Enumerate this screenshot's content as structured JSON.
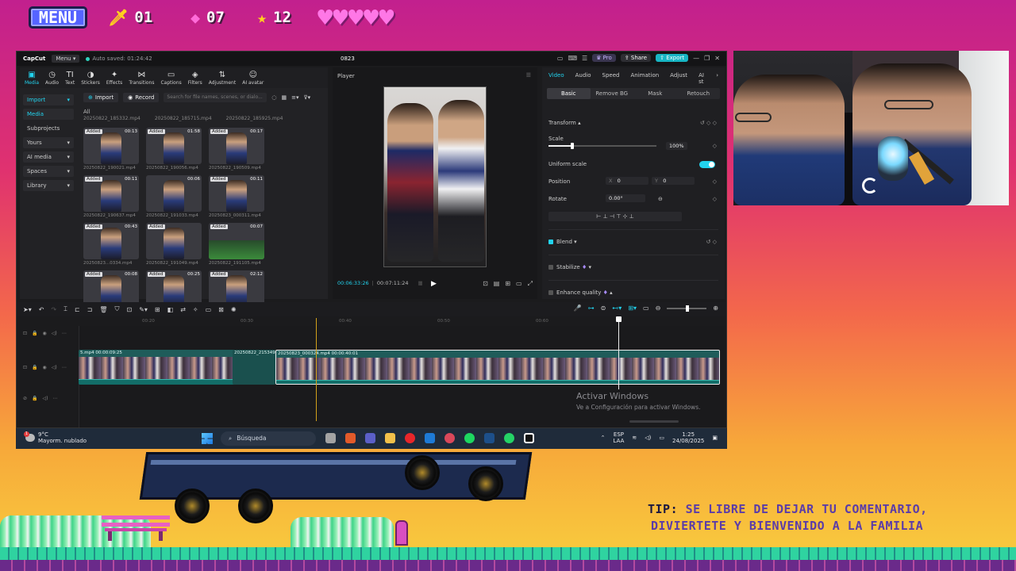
{
  "hud": {
    "menu_label": "MENU",
    "swords": "01",
    "gems": "07",
    "stars": "12",
    "hearts": "♥♥♥♥♥",
    "sword_icon": "sword-icon",
    "gem_icon": "gem-icon",
    "star_icon": "star-icon",
    "colors": {
      "menu_bg": "#5563ff",
      "hearts": "#ff77e6",
      "star": "#ffd21e"
    }
  },
  "capcut": {
    "app_name": "CapCut",
    "menu_label": "Menu",
    "auto_saved": "Auto saved: 01:24:42",
    "project_title": "0823",
    "pro_label": "Pro",
    "share_label": "Share",
    "export_label": "Export",
    "accent": "#22d3ee",
    "tools": [
      {
        "icon": "▣",
        "label": "Media"
      },
      {
        "icon": "◷",
        "label": "Audio"
      },
      {
        "icon": "TI",
        "label": "Text"
      },
      {
        "icon": "◑",
        "label": "Stickers"
      },
      {
        "icon": "✦",
        "label": "Effects"
      },
      {
        "icon": "⋈",
        "label": "Transitions"
      },
      {
        "icon": "▭",
        "label": "Captions"
      },
      {
        "icon": "◈",
        "label": "Filters"
      },
      {
        "icon": "⇅",
        "label": "Adjustment"
      },
      {
        "icon": "☺",
        "label": "AI avatar"
      }
    ],
    "side_nav": {
      "import": "Import",
      "media": "Media",
      "subprojects": "Subprojects",
      "yours": "Yours",
      "ai_media": "AI media",
      "spaces": "Spaces",
      "library": "Library"
    },
    "import_btn": "Import",
    "record_btn": "Record",
    "search_placeholder": "Search for file names, scenes, or dialo...",
    "all_label": "All",
    "top_files": [
      "20250822_185332.mp4",
      "20250822_185715.mp4",
      "20250822_185925.mp4"
    ],
    "clips": [
      {
        "badge": "Added",
        "duration": "00:13",
        "name": "20250822_190021.mp4"
      },
      {
        "badge": "Added",
        "duration": "01:58",
        "name": "20250822_190056.mp4"
      },
      {
        "badge": "Added",
        "duration": "00:17",
        "name": "20250822_190509.mp4"
      },
      {
        "badge": "Added",
        "duration": "00:11",
        "name": "20250822_190637.mp4"
      },
      {
        "badge": "",
        "duration": "00:06",
        "name": "20250822_191033.mp4"
      },
      {
        "badge": "Added",
        "duration": "00:11",
        "name": "20250823_000311.mp4"
      },
      {
        "badge": "Added",
        "duration": "00:43",
        "name": "20250823...0334.mp4"
      },
      {
        "badge": "Added",
        "duration": "",
        "name": "20250822_191049.mp4"
      },
      {
        "badge": "Added",
        "duration": "00:07",
        "name": "20250822_191105.mp4"
      },
      {
        "badge": "Added",
        "duration": "00:08",
        "name": ""
      },
      {
        "badge": "Added",
        "duration": "00:25",
        "name": ""
      },
      {
        "badge": "Added",
        "duration": "02:12",
        "name": ""
      }
    ],
    "player": {
      "title": "Player",
      "current": "00:06:33:26",
      "total": "00:07:11:24"
    },
    "inspector": {
      "tabs": [
        "Video",
        "Audio",
        "Speed",
        "Animation",
        "Adjust",
        "AI st"
      ],
      "sub_tabs": [
        "Basic",
        "Remove BG",
        "Mask",
        "Retouch"
      ],
      "transform": "Transform",
      "scale_label": "Scale",
      "scale_value": "100%",
      "scale_fraction": 0.22,
      "uniform_scale": "Uniform scale",
      "position_label": "Position",
      "pos_x_label": "X",
      "pos_x": "0",
      "pos_y_label": "Y",
      "pos_y": "0",
      "rotate_label": "Rotate",
      "rotate_value": "0.00°",
      "align_icons": "⊢ ⊥ ⊣ ⊤ ⊹ ⊥",
      "blend": "Blend",
      "stabilize": "Stabilize",
      "enhance": "Enhance quality"
    },
    "timeline": {
      "ruler": [
        "00:20",
        "00:30",
        "00:40",
        "00:50",
        "00:60"
      ],
      "clip1_label": "5.mp4  00:00:09:25",
      "clip2_label": "20250822_215349",
      "clip3_label": "20250823_000324.mp4  00:00:40:01"
    },
    "watermark": {
      "line1": "Activar Windows",
      "line2": "Ve a Configuración para activar Windows."
    }
  },
  "taskbar": {
    "weather_badge": "1",
    "temperature": "9°C",
    "weather_desc": "Mayorm. nublado",
    "search_label": "Búsqueda",
    "lang1": "ESP",
    "lang2": "LAA",
    "time": "1:25",
    "date": "24/08/2025",
    "app_colors": [
      "#a3a3a3",
      "#e25a2a",
      "#5b5fc7",
      "#f2c04a",
      "#e8262a",
      "#1e7ad6",
      "#d9485a",
      "#1ed760",
      "#1d4f8a",
      "#25d366",
      "#ffffff"
    ]
  },
  "tip": {
    "label": "TIP:",
    "line1": "SE LIBRE DE DEJAR TU COMENTARIO,",
    "line2": "DIVIERTETE Y BIENVENIDO A LA FAMILIA"
  }
}
